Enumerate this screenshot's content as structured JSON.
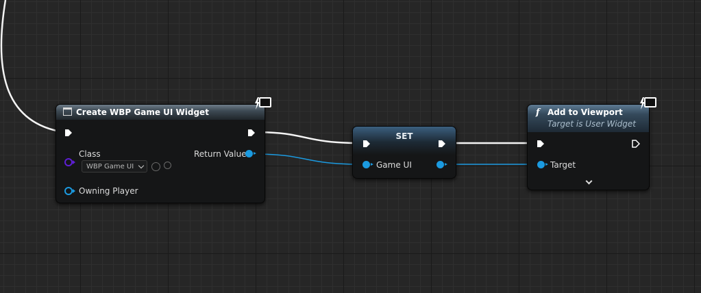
{
  "nodes": {
    "create_widget": {
      "title": "Create WBP Game UI Widget",
      "class_label": "Class",
      "class_value": "WBP Game UI",
      "return_value_label": "Return Value",
      "owning_player_label": "Owning Player"
    },
    "set_node": {
      "title": "SET",
      "game_ui_label": "Game UI"
    },
    "add_to_viewport": {
      "function_glyph": "f",
      "title": "Add to Viewport",
      "subtitle": "Target is User Widget",
      "target_label": "Target"
    }
  },
  "colors": {
    "object_pin": "#1b9ae0",
    "class_pin": "#5e1fd4",
    "exec_pin": "#ffffff",
    "grid_background": "#262626"
  },
  "icons": {
    "widget_node_icon": "widget-icon",
    "client_only": "monitor-lightning-icon",
    "function": "function-icon",
    "expand": "chevron-down-icon",
    "use_selected": "arrow-left-circle-icon",
    "browse": "search-icon"
  }
}
